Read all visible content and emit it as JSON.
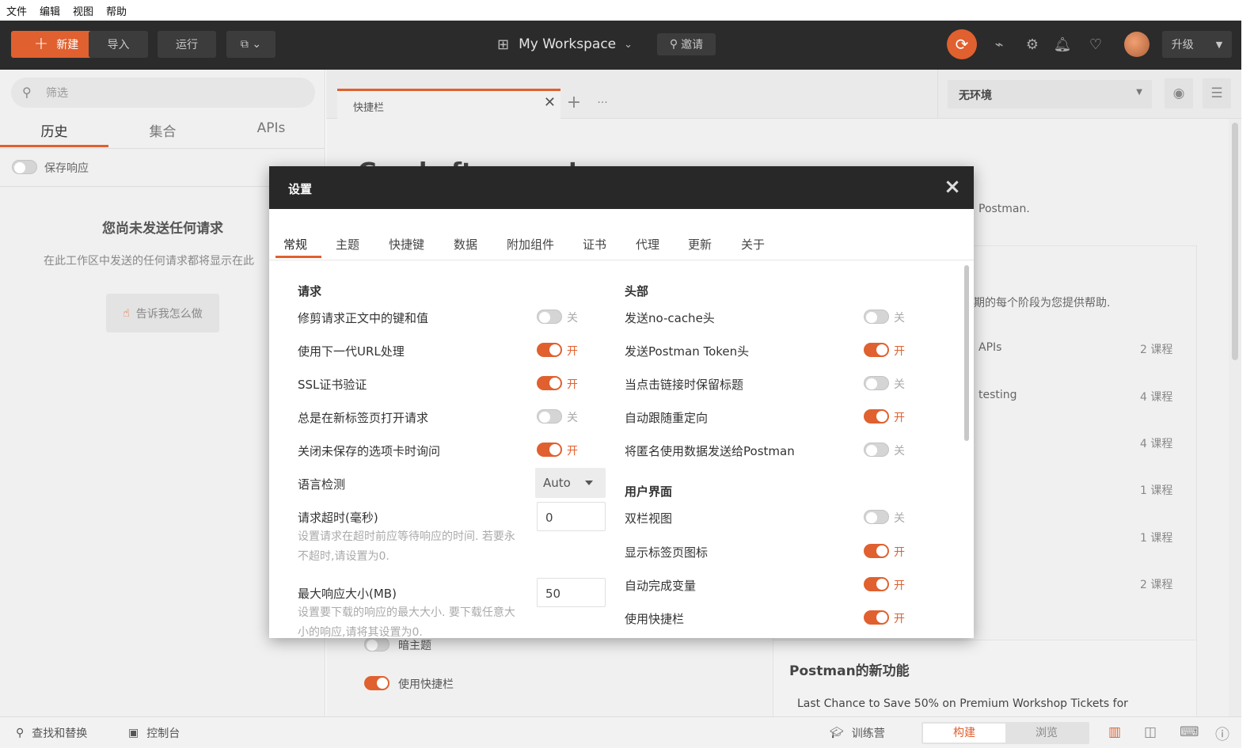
{
  "menubar": [
    "文件",
    "编辑",
    "视图",
    "帮助"
  ],
  "header": {
    "new_label": "新建",
    "import_label": "导入",
    "runner_label": "运行",
    "workspace": "My Workspace",
    "invite": "邀请",
    "upgrade": "升级"
  },
  "sidebar": {
    "filter_placeholder": "筛选",
    "tabs": [
      "历史",
      "集合",
      "APIs"
    ],
    "save_responses": "保存响应",
    "empty_title": "您尚未发送任何请求",
    "empty_desc": "在此工作区中发送的任何请求都将显示在此",
    "show_me": "告诉我怎么做"
  },
  "tabs": {
    "launchpad": "快捷栏"
  },
  "env": {
    "selected": "无环境"
  },
  "background": {
    "postman_text": "Postman.",
    "help_text": "期的每个阶段为您提供帮助.",
    "courses": [
      {
        "name": "APIs",
        "count": "2 课程"
      },
      {
        "name": "testing",
        "count": "4 课程"
      },
      {
        "name": "",
        "count": "4 课程"
      },
      {
        "name": "",
        "count": "1 课程"
      },
      {
        "name": "",
        "count": "1 课程"
      },
      {
        "name": "",
        "count": "2 课程"
      }
    ],
    "dark_theme": "暗主题",
    "use_launchpad": "使用快捷栏",
    "whats_new_title": "Postman的新功能",
    "whats_new_item": "Last Chance to Save 50% on Premium Workshop Tickets for"
  },
  "statusbar": {
    "find_replace": "查找和替换",
    "console": "控制台",
    "bootcamp": "训练营",
    "build": "构建",
    "browse": "浏览"
  },
  "modal": {
    "title": "设置",
    "tabs": [
      "常规",
      "主题",
      "快捷键",
      "数据",
      "附加组件",
      "证书",
      "代理",
      "更新",
      "关于"
    ],
    "on": "开",
    "off": "关",
    "request": {
      "title": "请求",
      "items": [
        {
          "label": "修剪请求正文中的键和值",
          "on": false
        },
        {
          "label": "使用下一代URL处理",
          "on": true
        },
        {
          "label": "SSL证书验证",
          "on": true
        },
        {
          "label": "总是在新标签页打开请求",
          "on": false
        },
        {
          "label": "关闭未保存的选项卡时询问",
          "on": true
        }
      ],
      "language_detection": "语言检测",
      "language_value": "Auto",
      "timeout_label": "请求超时(毫秒)",
      "timeout_value": "0",
      "timeout_hint": "设置请求在超时前应等待响应的时间. 若要永不超时,请设置为0.",
      "max_size_label": "最大响应大小(MB)",
      "max_size_value": "50",
      "max_size_hint": "设置要下载的响应的最大大小. 要下载任意大小的响应,请将其设置为0."
    },
    "headers": {
      "title": "头部",
      "items": [
        {
          "label": "发送no-cache头",
          "on": false
        },
        {
          "label": "发送Postman Token头",
          "on": true
        },
        {
          "label": "当点击链接时保留标题",
          "on": false
        },
        {
          "label": "自动跟随重定向",
          "on": true
        },
        {
          "label": "将匿名使用数据发送给Postman",
          "on": false
        }
      ]
    },
    "ui": {
      "title": "用户界面",
      "items": [
        {
          "label": "双栏视图",
          "on": false
        },
        {
          "label": "显示标签页图标",
          "on": true
        },
        {
          "label": "自动完成变量",
          "on": true
        },
        {
          "label": "使用快捷栏",
          "on": true
        }
      ]
    }
  }
}
